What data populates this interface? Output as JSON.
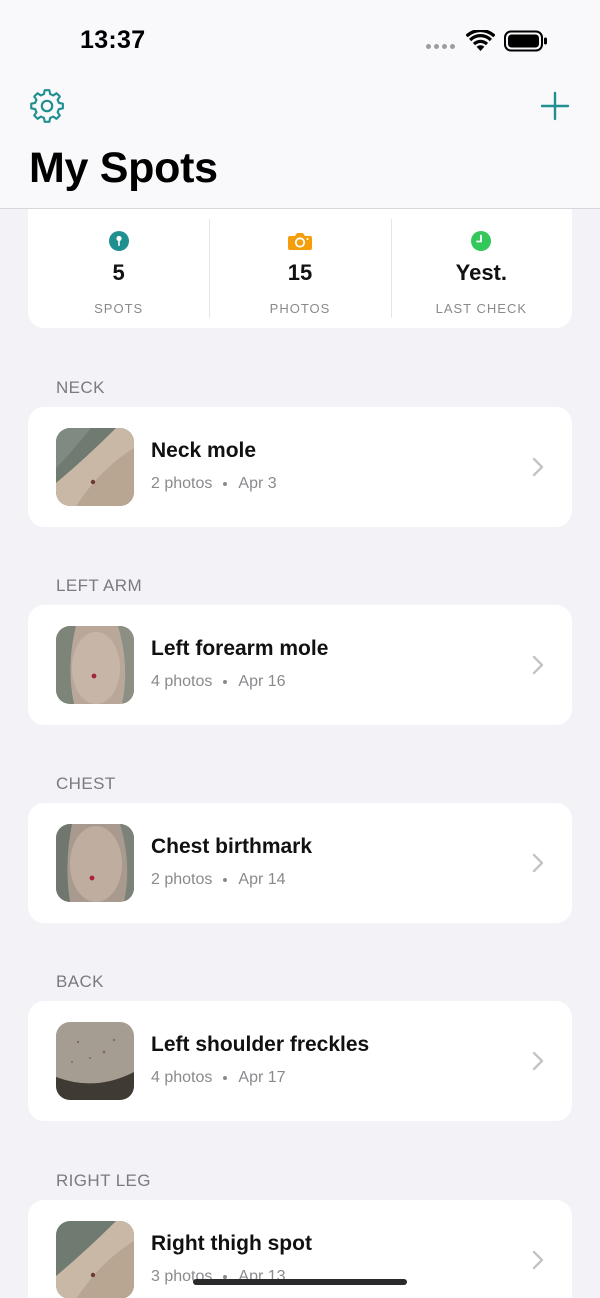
{
  "status_bar": {
    "time": "13:37"
  },
  "header": {
    "title": "My Spots",
    "settings_icon": "gear-icon",
    "add_icon": "plus-icon",
    "accent_color": "#1f8f8f"
  },
  "stats": [
    {
      "value": "5",
      "label": "SPOTS",
      "icon": "pin-icon",
      "color": "#1f8f8f"
    },
    {
      "value": "15",
      "label": "PHOTOS",
      "icon": "camera-icon",
      "color": "#f59e0b"
    },
    {
      "value": "Yest.",
      "label": "LAST CHECK",
      "icon": "clock-icon",
      "color": "#34c759"
    }
  ],
  "sections": [
    {
      "title": "NECK",
      "spot": {
        "name": "Neck mole",
        "photos": "2 photos",
        "date": "Apr 3"
      }
    },
    {
      "title": "LEFT ARM",
      "spot": {
        "name": "Left forearm mole",
        "photos": "4 photos",
        "date": "Apr 16"
      }
    },
    {
      "title": "CHEST",
      "spot": {
        "name": "Chest birthmark",
        "photos": "2 photos",
        "date": "Apr 14"
      }
    },
    {
      "title": "BACK",
      "spot": {
        "name": "Left shoulder freckles",
        "photos": "4 photos",
        "date": "Apr 17"
      }
    },
    {
      "title": "RIGHT LEG",
      "spot": {
        "name": "Right thigh spot",
        "photos": "3 photos",
        "date": "Apr 13"
      }
    }
  ]
}
